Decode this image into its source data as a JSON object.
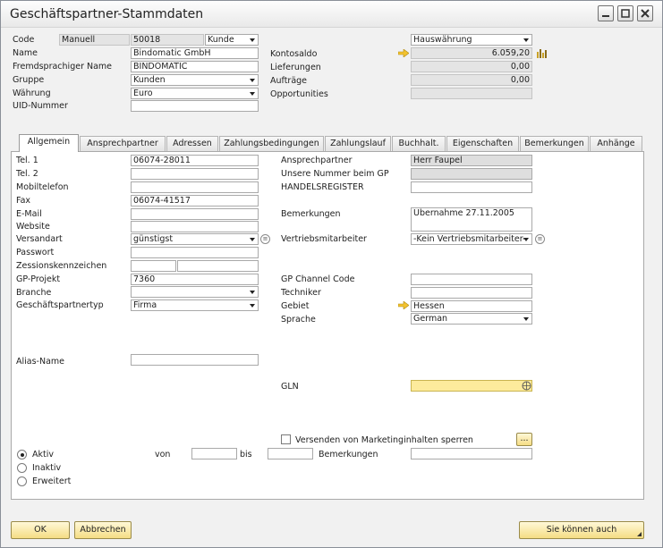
{
  "window": {
    "title": "Geschäftspartner-Stammdaten"
  },
  "header": {
    "code_label": "Code",
    "series": "Manuell",
    "code": "50018",
    "type": "Kunde",
    "name_label": "Name",
    "name": "Bindomatic GmbH",
    "foreign_name_label": "Fremdsprachiger Name",
    "foreign_name": "BINDOMATIC",
    "group_label": "Gruppe",
    "group": "Kunden",
    "currency_label": "Währung",
    "currency": "Euro",
    "uid_label": "UID-Nummer",
    "uid": "",
    "currency_mode": "Hauswährung",
    "balance_label": "Kontosaldo",
    "balance": "6.059,20",
    "deliveries_label": "Lieferungen",
    "deliveries": "0,00",
    "orders_label": "Aufträge",
    "orders": "0,00",
    "opportunities_label": "Opportunities",
    "opportunities": ""
  },
  "tabs": [
    "Allgemein",
    "Ansprechpartner",
    "Adressen",
    "Zahlungsbedingungen",
    "Zahlungslauf",
    "Buchhalt.",
    "Eigenschaften",
    "Bemerkungen",
    "Anhänge"
  ],
  "general": {
    "tel1_label": "Tel. 1",
    "tel1": "06074-28011",
    "tel2_label": "Tel. 2",
    "tel2": "",
    "mobile_label": "Mobiltelefon",
    "mobile": "",
    "fax_label": "Fax",
    "fax": "06074-41517",
    "email_label": "E-Mail",
    "email": "",
    "website_label": "Website",
    "website": "",
    "shipping_label": "Versandart",
    "shipping": "günstigst",
    "password_label": "Passwort",
    "password": "",
    "cession_label": "Zessionskennzeichen",
    "project_label": "GP-Projekt",
    "project": "7360",
    "industry_label": "Branche",
    "industry": "",
    "bptype_label": "Geschäftspartnertyp",
    "bptype": "Firma",
    "alias_label": "Alias-Name",
    "alias": "",
    "contact_label": "Ansprechpartner",
    "contact": "Herr Faupel",
    "ournum_label": "Unsere Nummer beim GP",
    "ournum": "",
    "register_label": "HANDELSREGISTER",
    "register": "",
    "remarks_label": "Bemerkungen",
    "remarks": "Übernahme 27.11.2005",
    "salesemp_label": "Vertriebsmitarbeiter",
    "salesemp": "-Kein Vertriebsmitarbeiter-",
    "channel_label": "GP Channel Code",
    "channel": "",
    "tech_label": "Techniker",
    "tech": "",
    "territory_label": "Gebiet",
    "territory": "Hessen",
    "lang_label": "Sprache",
    "lang": "German",
    "gln_label": "GLN",
    "gln": "",
    "marketing_label": "Versenden von Marketinginhalten sperren",
    "active_label": "Aktiv",
    "inactive_label": "Inaktiv",
    "advanced_label": "Erweitert",
    "from_label": "von",
    "to_label": "bis",
    "remarks2_label": "Bemerkungen",
    "more_label": "..."
  },
  "footer": {
    "ok": "OK",
    "cancel": "Abbrechen",
    "also": "Sie können auch"
  },
  "colors": {
    "accent_button": "#f5dd84",
    "gln_field": "#fdeb9c"
  }
}
